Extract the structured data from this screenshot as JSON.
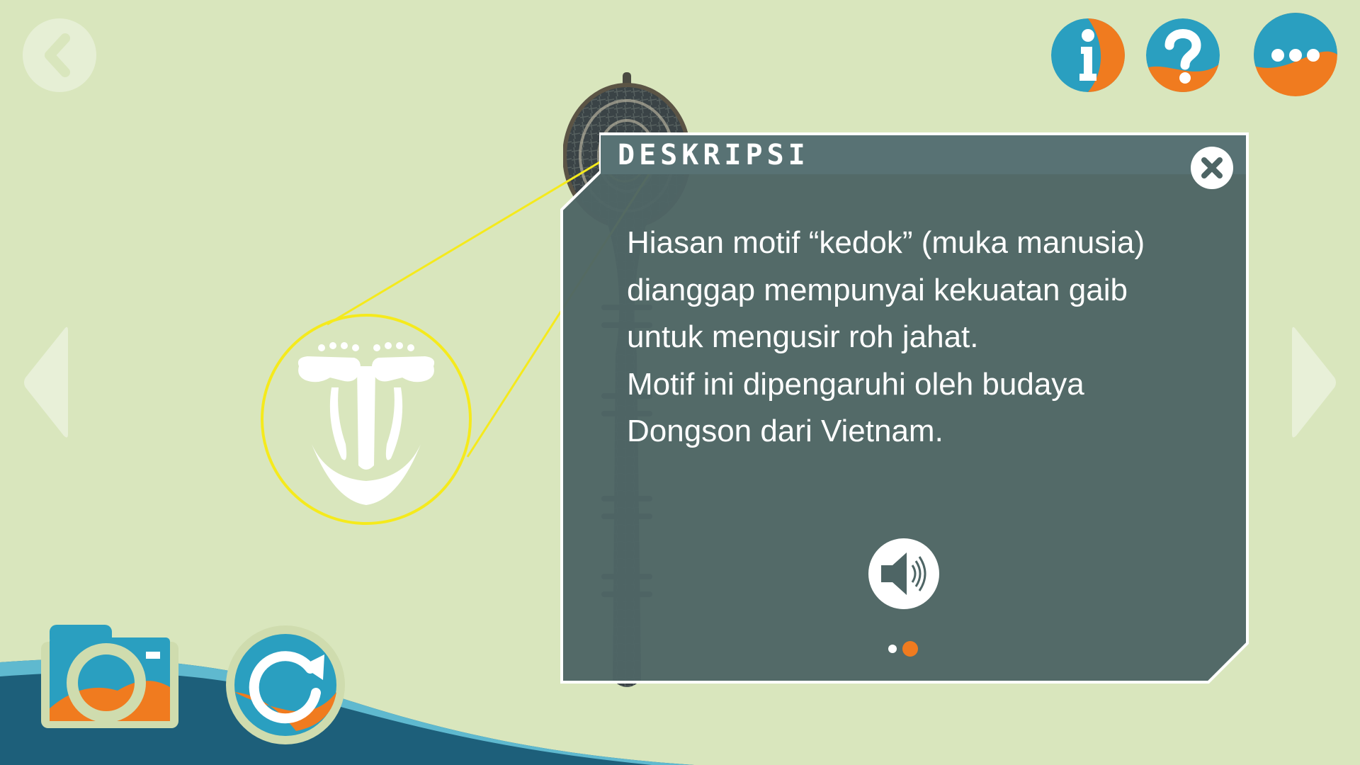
{
  "nav": {
    "back_icon": "chevron-left-icon",
    "prev_icon": "triangle-left-icon",
    "next_icon": "triangle-right-icon"
  },
  "top_buttons": {
    "info_icon": "info-icon",
    "help_icon": "question-mark-icon",
    "more_icon": "ellipsis-icon"
  },
  "panel": {
    "title": "DESKRIPSI",
    "text_1": "Hiasan motif “kedok” (muka manusia) dianggap mempunyai kekuatan gaib untuk mengusir roh jahat.",
    "text_2": "Motif ini dipengaruhi oleh budaya Dongson dari Vietnam.",
    "close_icon": "close-icon",
    "audio_icon": "speaker-icon",
    "page_count": 2,
    "active_page": 2
  },
  "bottom_buttons": {
    "camera_icon": "camera-icon",
    "rotate_icon": "rotate-icon"
  },
  "colors": {
    "background": "#d9e6bd",
    "panel": "#4e6565",
    "panel_header": "#587274",
    "accent_orange": "#f07b1f",
    "accent_teal": "#2a9fc0",
    "highlight": "#f5ea1c"
  }
}
